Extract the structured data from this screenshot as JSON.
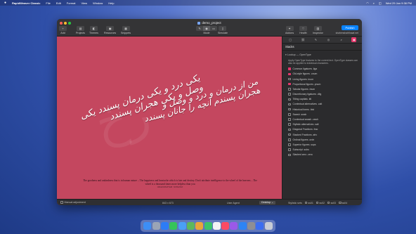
{
  "menubar": {
    "app": "RapidWeaver Classic",
    "items": [
      "File",
      "Edit",
      "Format",
      "View",
      "Window",
      "Help"
    ],
    "clock": "Wed 29 Jan 9:38 PM"
  },
  "window": {
    "title": "demo_project",
    "toolbar": {
      "add": "Add",
      "projects": "Projects",
      "themes": "Themes",
      "resources": "Resources",
      "snippets": "Snippets",
      "mode": "Mode",
      "simulate": "Simulate",
      "addons": "Addons",
      "health": "Health",
      "inspector": "Inspector",
      "publish": "Publish",
      "url": "shahenshahfinaaf.net"
    },
    "calligraphy_1": "یکی درد و یکی درمان پسندد  یکی وصل و یکی هجران پسندد",
    "calligraphy_2": "من از درمان و درد و وصل و هجران  پسندم آنچه را جانان پسندد",
    "watermark": "رخ",
    "quote": "The goodness and unkindness that is in human nature – The happiness and heartache which is fate and destiny. Don't attribute intelligence to the wheel of the heavens – The wheel is a thousand times more helpless than you",
    "quote_attr": "OMAR KHAYYAM · RUBAIYAT",
    "bottom": {
      "manual": "Manual adjustment",
      "size": "843 x 673",
      "agent_label": "User Agent",
      "agent_value": "Desktop",
      "stylistic": "Stylistic sets",
      "ss": [
        "ss01",
        "ss02",
        "ss03",
        "ss04"
      ]
    }
  },
  "panel": {
    "heading": "Stacks",
    "lookup": "Lookup — OpenType",
    "description": "Apply OpenType features to the current text. OpenType classes can also be applied to individual characters.",
    "features": [
      {
        "label": "Common ligatures .liga",
        "on": true
      },
      {
        "label": "Old-style figures .onum",
        "on": true
      },
      {
        "label": "Lining figures .lnum",
        "on": false
      },
      {
        "label": "Proportional figures .pnum",
        "on": true
      },
      {
        "label": "Tabular figures .tnum",
        "on": false
      },
      {
        "label": "Discretionary ligatures .dlig",
        "on": false
      },
      {
        "label": "Titling capitals .titl",
        "on": false
      },
      {
        "label": "Contextual alternatives .calt",
        "on": false
      },
      {
        "label": "Historical forms .hist",
        "on": false
      },
      {
        "label": "Swash .swsh",
        "on": false
      },
      {
        "label": "Contextual swash .cswh",
        "on": false
      },
      {
        "label": "Stylistic alternatives .salt",
        "on": false
      },
      {
        "label": "Diagonal Fractions .frac",
        "on": false
      },
      {
        "label": "Stacked Fractions .afrc",
        "on": false
      },
      {
        "label": "Ordinal figures .ordn",
        "on": false
      },
      {
        "label": "Superior figures .sups",
        "on": false
      },
      {
        "label": "Subscript .subs",
        "on": false
      },
      {
        "label": "Slashed zero .zero",
        "on": false
      }
    ]
  },
  "colors": {
    "page": "#c4475f",
    "accent": "#e3386c",
    "publish": "#0a84ff"
  },
  "dock_icons": [
    "finder-icon",
    "launchpad-icon",
    "safari-icon",
    "messages-icon",
    "mail-icon",
    "maps-icon",
    "photos-icon",
    "facetime-icon",
    "calendar-icon",
    "music-icon",
    "podcasts-icon",
    "appstore-icon",
    "settings-icon",
    "rapidweaver-icon",
    "trash-icon"
  ]
}
